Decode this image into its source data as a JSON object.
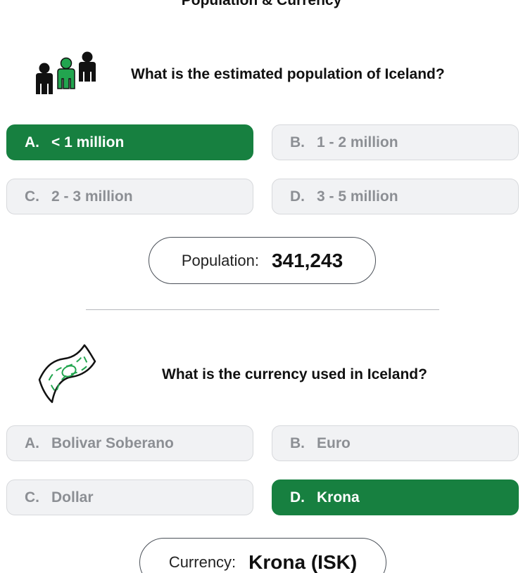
{
  "page_title": "Population & Currency",
  "colors": {
    "selected_bg": "#178040",
    "option_bg": "#f1f2f4",
    "option_text": "#8c8f94",
    "icon_accent": "#22a54f"
  },
  "section_population": {
    "icon": "people-icon",
    "question": "What is the estimated population of Iceland?",
    "options": [
      {
        "letter": "A.",
        "text": "< 1 million",
        "selected": true
      },
      {
        "letter": "B.",
        "text": "1 - 2 million",
        "selected": false
      },
      {
        "letter": "C.",
        "text": "2 - 3 million",
        "selected": false
      },
      {
        "letter": "D.",
        "text": "3 - 5 million",
        "selected": false
      }
    ],
    "answer_label": "Population:",
    "answer_value": "341,243"
  },
  "section_currency": {
    "icon": "banknote-icon",
    "question": "What is the currency used in Iceland?",
    "options": [
      {
        "letter": "A.",
        "text": "Bolivar Soberano",
        "selected": false
      },
      {
        "letter": "B.",
        "text": "Euro",
        "selected": false
      },
      {
        "letter": "C.",
        "text": "Dollar",
        "selected": false
      },
      {
        "letter": "D.",
        "text": "Krona",
        "selected": true
      }
    ],
    "answer_label": "Currency:",
    "answer_value": "Krona (ISK)"
  }
}
